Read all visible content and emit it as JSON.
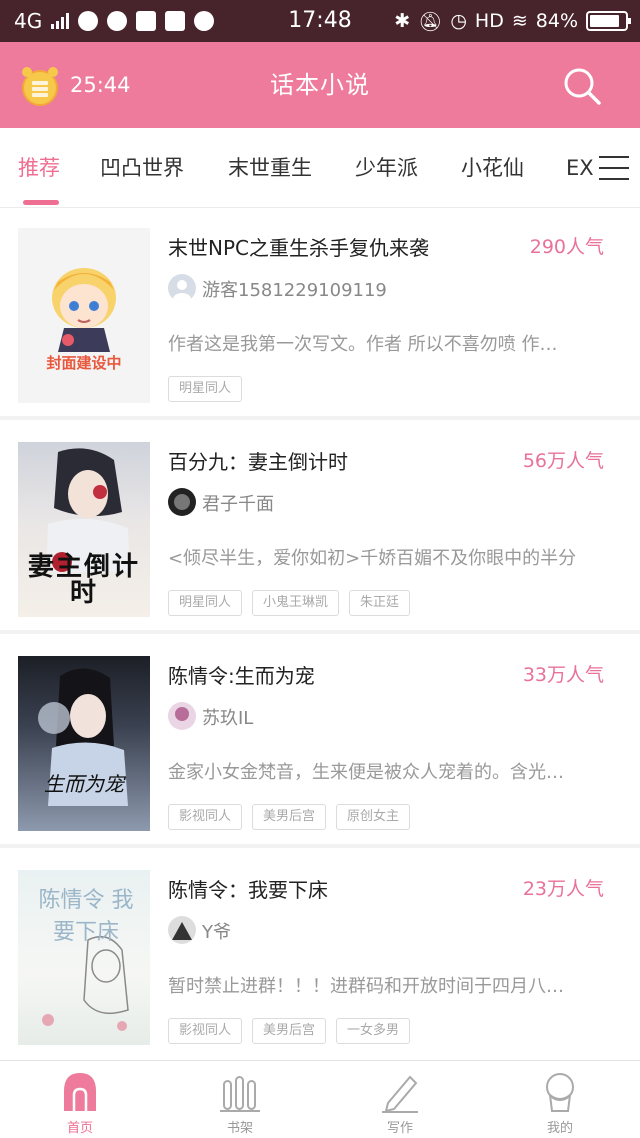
{
  "status_bar": {
    "network": "4G",
    "time": "17:48",
    "hd": "HD",
    "battery": "84%",
    "battery_level": 0.84
  },
  "header": {
    "timer": "25:44",
    "title": "话本小说",
    "accent_color": "#ee7b9c"
  },
  "tabs": [
    {
      "label": "推荐",
      "active": true
    },
    {
      "label": "凹凸世界"
    },
    {
      "label": "末世重生"
    },
    {
      "label": "少年派"
    },
    {
      "label": "小花仙"
    },
    {
      "label": "EX"
    }
  ],
  "books": [
    {
      "title": "末世NPC之重生杀手复仇来袭",
      "popularity": "290人气",
      "author": "游客1581229109119",
      "description": "作者这是我第一次写文。作者 所以不喜勿喷 作…",
      "tags": [
        "明星同人"
      ],
      "cover_text": "封面建设中"
    },
    {
      "title": "百分九：妻主倒计时",
      "popularity": "56万人气",
      "author": "君子千面",
      "description": "<倾尽半生，爱你如初>千娇百媚不及你眼中的半分",
      "tags": [
        "明星同人",
        "小鬼王琳凯",
        "朱正廷"
      ],
      "cover_text": "妻主倒计时"
    },
    {
      "title": "陈情令:生而为宠",
      "popularity": "33万人气",
      "author": "苏玖IL",
      "description": "金家小女金梵音，生来便是被众人宠着的。含光…",
      "tags": [
        "影视同人",
        "美男后宫",
        "原创女主"
      ],
      "cover_text": "生而为宠"
    },
    {
      "title": "陈情令：我要下床",
      "popularity": "23万人气",
      "author": "Y爷",
      "description": "暂时禁止进群！！！进群码和开放时间于四月八…",
      "tags": [
        "影视同人",
        "美男后宫",
        "一女多男"
      ],
      "cover_text": "陈情令 我要下床"
    }
  ],
  "bottom_nav": [
    {
      "label": "首页",
      "icon": "home-icon",
      "active": true
    },
    {
      "label": "书架",
      "icon": "bookshelf-icon"
    },
    {
      "label": "写作",
      "icon": "pen-icon"
    },
    {
      "label": "我的",
      "icon": "profile-icon"
    }
  ]
}
